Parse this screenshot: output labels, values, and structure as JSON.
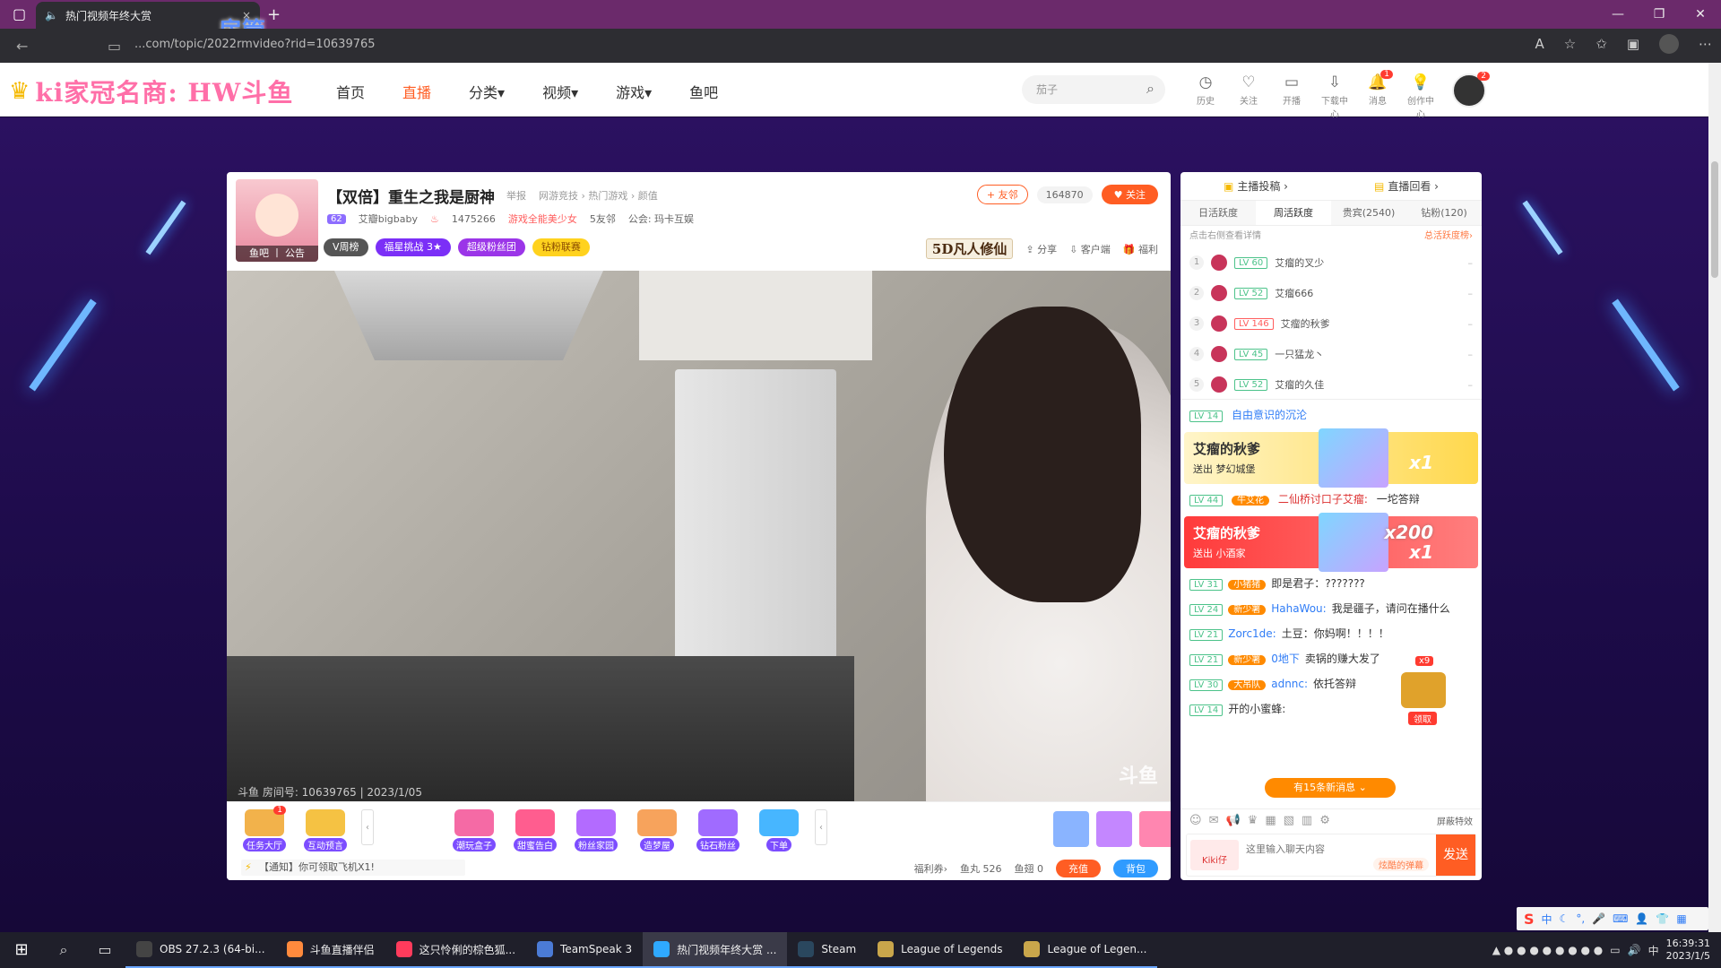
{
  "browser": {
    "tab_title": "热门视频年终大赏",
    "url": "...com/topic/2022rmvideo?rid=10639765",
    "overlay_text": "房管"
  },
  "site": {
    "logo_text": "ki家冠名商: HW斗鱼",
    "nav": [
      "首页",
      "直播",
      "分类",
      "视频",
      "游戏",
      "鱼吧"
    ],
    "active_nav": "直播",
    "search_placeholder": "茄子",
    "tools": [
      {
        "icon": "history-icon",
        "label": "历史"
      },
      {
        "icon": "heart-icon",
        "label": "关注"
      },
      {
        "icon": "broadcast-icon",
        "label": "开播"
      },
      {
        "icon": "download-icon",
        "label": "下载中心"
      },
      {
        "icon": "bell-icon",
        "label": "消息",
        "badge": "1"
      },
      {
        "icon": "bulb-icon",
        "label": "创作中心"
      }
    ],
    "avatar_badge": "2"
  },
  "room": {
    "title": "【双倍】重生之我是厨神",
    "report": "举报",
    "categories": "网游竞技 › 热门游戏 › 颜值",
    "level": "62",
    "streamer": "艾瓣bigbaby",
    "hot": "1475266",
    "tag_red": "游戏全能美少女",
    "friends": "5友邻",
    "guild": "公会: 玛卡互娱",
    "avatar_strip": "鱼吧 丨 公告",
    "tags": [
      "V周榜",
      "福星挑战 3★",
      "超级粉丝团",
      "钻粉联赛"
    ],
    "btn_friend": "+ 友邻",
    "follow_count": "164870",
    "btn_follow": "♥ 关注",
    "game_logo": "5D凡人修仙",
    "share": "分享",
    "client": "客户端",
    "welfare": "福利",
    "video_room": "斗鱼 房间号: 10639765 | 2023/1/05",
    "video_wm": "斗鱼"
  },
  "gifts": {
    "left": [
      {
        "label": "任务大厅",
        "badge": "1",
        "color": "#f2b24b"
      },
      {
        "label": "互动预言",
        "badge": "",
        "color": "#f5c243"
      }
    ],
    "mid": [
      {
        "label": "潮玩盒子",
        "color": "#f56aa5"
      },
      {
        "label": "甜蜜告白",
        "color": "#ff5d8f"
      },
      {
        "label": "粉丝家园",
        "color": "#b36bff"
      },
      {
        "label": "造梦屋",
        "color": "#f7a35c"
      },
      {
        "label": "钻石粉丝",
        "color": "#a06bff"
      },
      {
        "label": "下单",
        "color": "#47b6ff"
      }
    ],
    "icon_colors": [
      "#8ab4ff",
      "#c487ff",
      "#ff86b0",
      "#7fe3c8",
      "#ffcf6b",
      "#93d6ff",
      "#c9a64b"
    ],
    "notice": "【通知】你可领取飞机X1!",
    "welfare_card": "福利券›",
    "fish_ball": "鱼丸 526",
    "fish_fin": "鱼翅 0",
    "btn_charge": "充值",
    "btn_bag": "背包"
  },
  "side": {
    "top_left": "主播投稿 ›",
    "top_right": "直播回看 ›",
    "rank_tabs": [
      "日活跃度",
      "周活跃度",
      "贵宾(2540)",
      "钻粉(120)"
    ],
    "active_rank_tab": "周活跃度",
    "hint_left": "点击右侧查看详情",
    "hint_right": "总活跃度榜›",
    "ranks": [
      {
        "num": "1",
        "lv": "LV 60",
        "name": "艾瘤的叉少",
        "red": false
      },
      {
        "num": "2",
        "lv": "LV 52",
        "name": "艾瘤666",
        "red": false
      },
      {
        "num": "3",
        "lv": "LV 146",
        "name": "艾瘤的秋爹",
        "red": true
      },
      {
        "num": "4",
        "lv": "LV 45",
        "name": "一只猛龙丶",
        "red": false
      },
      {
        "num": "5",
        "lv": "LV 52",
        "name": "艾瘤的久佳",
        "red": false
      }
    ],
    "chat_top": {
      "lv": "LV 14",
      "text": "自由意识的沉沦"
    },
    "banner1": {
      "name": "艾瘤的秋爹",
      "send": "送出",
      "gift": "梦幻城堡",
      "mult": "x1"
    },
    "chat2": {
      "lv": "LV 44",
      "fan": "牛艾花",
      "nick": "二仙桥讨口子艾瘤:",
      "text": "一坨答辩"
    },
    "banner2": {
      "name": "艾瘤的秋爹",
      "send": "送出",
      "gift": "小酒家",
      "mult": "x200",
      "mult2": "x1"
    },
    "chats": [
      {
        "lv": "LV 31",
        "fan": "小猪猪",
        "nick": "",
        "text": "即是君子：???????"
      },
      {
        "lv": "LV 24",
        "fan": "新少署",
        "nick": "HahaWou:",
        "text": "我是疆子，请问在播什么"
      },
      {
        "lv": "LV 21",
        "fan": "",
        "nick": "Zorc1de:",
        "text": "土豆：你妈啊！！！！"
      },
      {
        "lv": "LV 21",
        "fan": "新少署",
        "nick": "0地下",
        "text": "卖锅的赚大发了"
      },
      {
        "lv": "LV 30",
        "fan": "大吊队",
        "nick": "adnnc:",
        "text": "依托答辩"
      },
      {
        "lv": "LV 14",
        "fan": "",
        "nick": "",
        "text": "开的小蜜蜂:"
      }
    ],
    "box_count": "x9",
    "box_label": "领取",
    "new_msg": "有15条新消息 ⌄",
    "shield": "屏蔽特效",
    "input_placeholder": "这里输入聊天内容",
    "fan_badge": "Kiki仔",
    "bullet": "炫酷的弹幕",
    "send": "发送"
  },
  "taskbar": {
    "apps": [
      {
        "label": "OBS 27.2.3 (64-bi...",
        "color": "#444"
      },
      {
        "label": "斗鱼直播伴侣",
        "color": "#ff8a3d"
      },
      {
        "label": "这只怜俐的棕色狐...",
        "color": "#ff3b5c"
      },
      {
        "label": "TeamSpeak 3",
        "color": "#4b7bd6"
      },
      {
        "label": "热门视频年终大赏 ...",
        "color": "#2fa9ff"
      },
      {
        "label": "Steam",
        "color": "#2a475e"
      },
      {
        "label": "League of Legends",
        "color": "#c9a64b"
      },
      {
        "label": "League of Legen...",
        "color": "#c9a64b"
      }
    ],
    "active_app": "热门视频年终大赏 ...",
    "time": "16:39:31",
    "date": "2023/1/5",
    "ime": "中"
  }
}
